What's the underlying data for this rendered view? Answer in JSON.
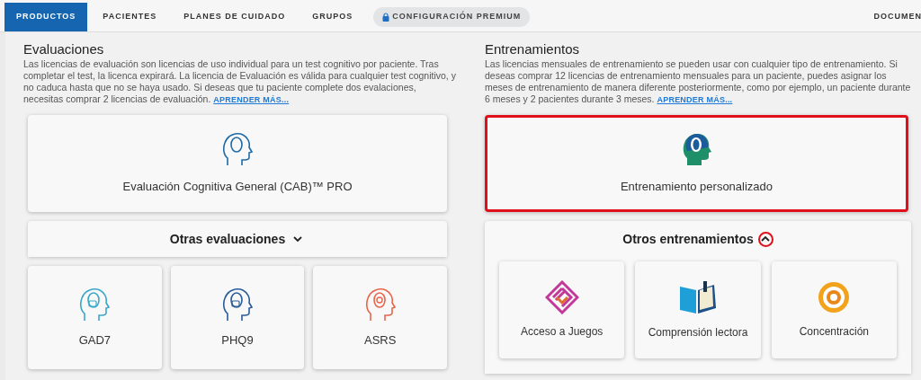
{
  "nav": {
    "tabs": [
      {
        "label": "PRODUCTOS",
        "selected": true,
        "kind": "tab"
      },
      {
        "label": "PACIENTES",
        "selected": false,
        "kind": "tab"
      },
      {
        "label": "PLANES DE CUIDADO",
        "selected": false,
        "kind": "tab"
      },
      {
        "label": "GRUPOS",
        "selected": false,
        "kind": "tab"
      },
      {
        "label": "CONFIGURACIÓN PREMIUM",
        "selected": false,
        "kind": "locked"
      }
    ],
    "right_label": "DOCUMEN"
  },
  "sections": [
    {
      "title": "Evaluaciones",
      "text": "Las licencias de evaluación son licencias de uso individual para un test cognitivo por paciente. Tras completar el test, la licenca expirará. La licencia de Evaluación es válida para cualquier test cognitivo, y no caduca hasta que no se haya usado. Si deseas que tu paciente complete dos evalaciones, necesitas comprar 2 licencias de evaluación.",
      "link": "APRENDER MÁS...",
      "main_card": {
        "label": "Evaluación Cognitiva General (CAB)™ PRO",
        "highlighted": false,
        "kind": "head-outline"
      },
      "more": {
        "label": "Otras evaluaciones",
        "expanded": false,
        "highlighted": false
      },
      "cards": [
        {
          "label": "GAD7",
          "kind": "head-cyan"
        },
        {
          "label": "PHQ9",
          "kind": "head-blue"
        },
        {
          "label": "ASRS",
          "kind": "head-target"
        }
      ]
    },
    {
      "title": "Entrenamientos",
      "text": "Las licencias mensuales de entrenamiento se pueden usar con cualquier tipo de entrenamiento. Si deseas comprar 12 licencias de entrenamiento mensuales para un paciente, puedes asignar los meses de entrenamiento de manera diferente posteriormente, como por ejemplo, un paciente durante 6 meses y 2 pacientes durante 3 meses.",
      "link": "APRENDER MÁS...",
      "main_card": {
        "label": "Entrenamiento personalizado",
        "highlighted": true,
        "kind": "head-solid"
      },
      "more": {
        "label": "Otros entrenamientos",
        "expanded": true,
        "highlighted": true
      },
      "cards": [
        {
          "label": "Acceso a Juegos",
          "kind": "maze"
        },
        {
          "label": "Comprensión lectora",
          "kind": "book"
        },
        {
          "label": "Concentración",
          "kind": "target"
        }
      ]
    }
  ]
}
